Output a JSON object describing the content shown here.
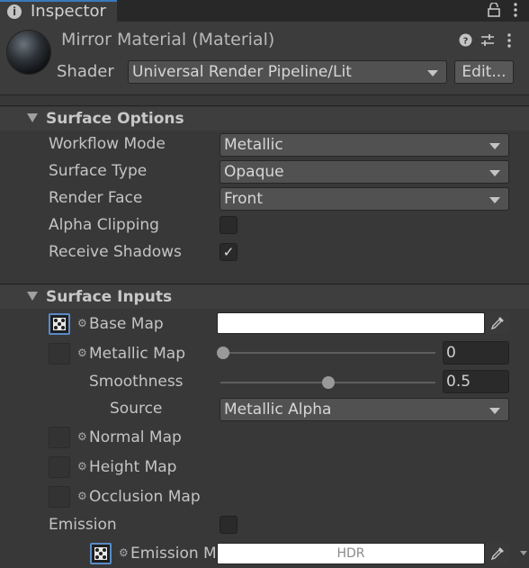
{
  "tab": {
    "label": "Inspector",
    "info_icon": "i"
  },
  "tab_icons": {
    "lock": "lock-icon",
    "menu": "kebab-menu-icon"
  },
  "header": {
    "title": "Mirror Material (Material)",
    "shader_label": "Shader",
    "shader_value": "Universal Render Pipeline/Lit",
    "edit_label": "Edit...",
    "icons": [
      "help-icon",
      "preset-icon",
      "kebab-menu-icon"
    ]
  },
  "surface_options": {
    "title": "Surface Options",
    "workflow_mode_label": "Workflow Mode",
    "workflow_mode_value": "Metallic",
    "surface_type_label": "Surface Type",
    "surface_type_value": "Opaque",
    "render_face_label": "Render Face",
    "render_face_value": "Front",
    "alpha_clipping_label": "Alpha Clipping",
    "alpha_clipping_checked": false,
    "receive_shadows_label": "Receive Shadows",
    "receive_shadows_checked": true,
    "check_glyph": "✓"
  },
  "surface_inputs": {
    "title": "Surface Inputs",
    "base_map_label": "Base Map",
    "base_map_color": "#FFFFFF",
    "metallic_map_label": "Metallic Map",
    "metallic_value": "0",
    "metallic_fraction": 0,
    "smoothness_label": "Smoothness",
    "smoothness_value": "0.5",
    "smoothness_fraction": 0.5,
    "source_label": "Source",
    "source_value": "Metallic Alpha",
    "normal_map_label": "Normal Map",
    "height_map_label": "Height Map",
    "occlusion_map_label": "Occlusion Map",
    "emission_label": "Emission",
    "emission_checked": true,
    "emission_map_label": "Emission M",
    "emission_hdr": "HDR",
    "emission_color": "#FFFFFF",
    "gear_glyph": "⚙"
  },
  "colors": {
    "accent": "#3A79BB",
    "panel": "#383838",
    "header": "#3C3C3C"
  }
}
